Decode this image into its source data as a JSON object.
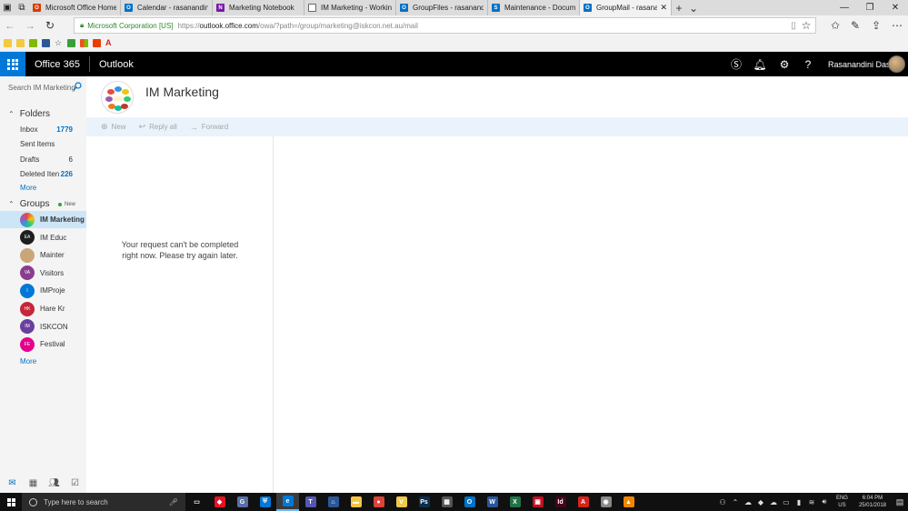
{
  "browser": {
    "tabs": [
      {
        "title": "Microsoft Office Home",
        "color": "#d83b01",
        "glyph": "O"
      },
      {
        "title": "Calendar - rasanandinidasi@",
        "color": "#0072c6",
        "glyph": "O"
      },
      {
        "title": "Marketing Notebook",
        "color": "#7719aa",
        "glyph": "N"
      },
      {
        "title": "IM Marketing - Working Fol",
        "color": "#ffffff",
        "glyph": ""
      },
      {
        "title": "GroupFiles - rasanandinidas",
        "color": "#0072c6",
        "glyph": "O"
      },
      {
        "title": "Maintenance - Documents",
        "color": "#0072c6",
        "glyph": "S"
      },
      {
        "title": "GroupMail - rasanandin",
        "color": "#0072c6",
        "glyph": "O"
      }
    ],
    "active_tab": 6,
    "cert_label": "Microsoft Corporation [US]",
    "url_scheme": "https://",
    "url_host": "outlook.office.com",
    "url_path": "/owa/?path=/group/marketing@iskcon.net.au/mail"
  },
  "suite": {
    "name": "Office 365",
    "app": "Outlook",
    "user_name": "Rasanandini Dasi"
  },
  "search": {
    "placeholder": "Search IM Marketing"
  },
  "folders": {
    "header": "Folders",
    "items": [
      {
        "label": "Inbox",
        "count": "1779",
        "highlight": true
      },
      {
        "label": "Sent Items",
        "count": ""
      },
      {
        "label": "Drafts",
        "count": "6",
        "highlight": false
      },
      {
        "label": "Deleted Iten",
        "count": "226",
        "highlight": true
      }
    ],
    "more": "More"
  },
  "groups": {
    "header": "Groups",
    "new_badge": "New",
    "items": [
      {
        "label": "IM Marketing",
        "initials": "",
        "color": "#ffffff"
      },
      {
        "label": "IM Educ",
        "initials": "EA",
        "color": "#1e1e1e"
      },
      {
        "label": "Mainter",
        "initials": "",
        "color": "#c9a67a"
      },
      {
        "label": "Visitors",
        "initials": "VA",
        "color": "#8a3d8f"
      },
      {
        "label": "IMProje",
        "initials": "I",
        "color": "#0078d7"
      },
      {
        "label": "Hare Kr",
        "initials": "HK",
        "color": "#c4263a"
      },
      {
        "label": "ISKCON",
        "initials": "IM",
        "color": "#6b3fa0"
      },
      {
        "label": "Festival",
        "initials": "FE",
        "color": "#e3008c"
      }
    ],
    "active": 0,
    "more": "More"
  },
  "group_page": {
    "title": "IM Marketing",
    "commands": {
      "new": "New",
      "reply_all": "Reply all",
      "forward": "Forward"
    },
    "error": "Your request can't be completed right now. Please try again later."
  },
  "taskbar": {
    "search_placeholder": "Type here to search",
    "apps": [
      {
        "name": "task-view",
        "color": "#101010",
        "glyph": "▭"
      },
      {
        "name": "app-diamond",
        "color": "#e81123",
        "glyph": "◆"
      },
      {
        "name": "app-chrome-like",
        "color": "#5a6fa8",
        "glyph": "G"
      },
      {
        "name": "app-defender",
        "color": "#0078d7",
        "glyph": "⛨"
      },
      {
        "name": "app-edge",
        "color": "#0078d7",
        "glyph": "e"
      },
      {
        "name": "app-teams",
        "color": "#5558af",
        "glyph": "T"
      },
      {
        "name": "app-store",
        "color": "#2b5797",
        "glyph": "⌂"
      },
      {
        "name": "app-explorer",
        "color": "#f4c542",
        "glyph": "▬"
      },
      {
        "name": "app-chrome",
        "color": "#db4437",
        "glyph": "●"
      },
      {
        "name": "app-vim",
        "color": "#f2c94c",
        "glyph": "V"
      },
      {
        "name": "app-photoshop",
        "color": "#0b2e4e",
        "glyph": "Ps"
      },
      {
        "name": "app-calculator",
        "color": "#555555",
        "glyph": "▦"
      },
      {
        "name": "app-outlook",
        "color": "#0072c6",
        "glyph": "O"
      },
      {
        "name": "app-word",
        "color": "#2b579a",
        "glyph": "W"
      },
      {
        "name": "app-excel",
        "color": "#217346",
        "glyph": "X"
      },
      {
        "name": "app-red",
        "color": "#c50f1f",
        "glyph": "▣"
      },
      {
        "name": "app-indesign",
        "color": "#49021f",
        "glyph": "Id"
      },
      {
        "name": "app-acrobat",
        "color": "#d8231b",
        "glyph": "A"
      },
      {
        "name": "app-media",
        "color": "#888888",
        "glyph": "◉"
      },
      {
        "name": "app-vlc",
        "color": "#f18700",
        "glyph": "▲"
      }
    ],
    "lang_top": "ENG",
    "lang_bottom": "US",
    "time": "6:04 PM",
    "date": "25/01/2018"
  }
}
